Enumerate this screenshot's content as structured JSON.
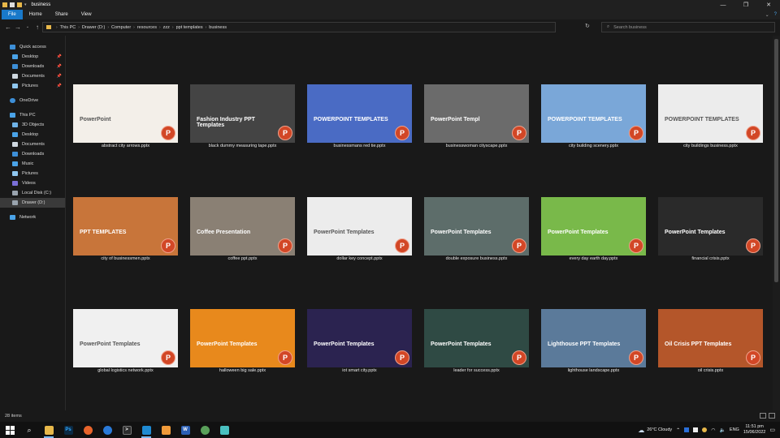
{
  "window": {
    "title": "business",
    "controls": [
      "—",
      "❐",
      "✕"
    ]
  },
  "ribbon": {
    "tabs": [
      "File",
      "Home",
      "Share",
      "View"
    ]
  },
  "address": {
    "crumbs": [
      "This PC",
      "Drawer (D:)",
      "Computer",
      "resources",
      "zzz",
      "ppt templates",
      "business"
    ],
    "search_placeholder": "Search business"
  },
  "sidebar": {
    "quick_access": {
      "label": "Quick access",
      "items": [
        "Desktop",
        "Downloads",
        "Documents",
        "Pictures"
      ]
    },
    "onedrive": "OneDrive",
    "this_pc": {
      "label": "This PC",
      "items": [
        "3D Objects",
        "Desktop",
        "Documents",
        "Downloads",
        "Music",
        "Pictures",
        "Videos",
        "Local Disk (C:)",
        "Drawer (D:)"
      ]
    },
    "network": "Network"
  },
  "files": [
    {
      "name": "abstract city arrows.pptx",
      "thumb_title": "PowerPoint",
      "bg": "#f3efe9"
    },
    {
      "name": "black dummy measuring tape.pptx",
      "thumb_title": "Fashion Industry PPT Templates",
      "bg": "#444444"
    },
    {
      "name": "businessmans red tie.pptx",
      "thumb_title": "POWERPOINT TEMPLATES",
      "bg": "#4a6bc4"
    },
    {
      "name": "businesswoman cityscape.pptx",
      "thumb_title": "PowerPoint Templ",
      "bg": "#6b6b6b"
    },
    {
      "name": "city building scenery.pptx",
      "thumb_title": "POWERPOINT TEMPLATES",
      "bg": "#7aa7d8"
    },
    {
      "name": "city buildings business.pptx",
      "thumb_title": "POWERPOINT TEMPLATES",
      "bg": "#ececec"
    },
    {
      "name": "city of businessmen.pptx",
      "thumb_title": "PPT TEMPLATES",
      "bg": "#c8753a"
    },
    {
      "name": "coffee ppt.pptx",
      "thumb_title": "Coffee Presentation",
      "bg": "#8a8074"
    },
    {
      "name": "dollar key concept.pptx",
      "thumb_title": "PowerPoint Templates",
      "bg": "#ececec"
    },
    {
      "name": "double exposure business.pptx",
      "thumb_title": "PowerPoint Templates",
      "bg": "#5d6d6a"
    },
    {
      "name": "every day earth day.pptx",
      "thumb_title": "PowerPoint Templates",
      "bg": "#79b94a"
    },
    {
      "name": "financial crisis.pptx",
      "thumb_title": "PowerPoint Templates",
      "bg": "#2a2a2a"
    },
    {
      "name": "global logistics network.pptx",
      "thumb_title": "PowerPoint Templates",
      "bg": "#f0f0f0"
    },
    {
      "name": "halloween big sale.pptx",
      "thumb_title": "PowerPoint Templates",
      "bg": "#e8891c"
    },
    {
      "name": "iot smart city.pptx",
      "thumb_title": "PowerPoint Templates",
      "bg": "#2b2350"
    },
    {
      "name": "leader for success.pptx",
      "thumb_title": "PowerPoint Templates",
      "bg": "#2f4a44"
    },
    {
      "name": "lighthouse landscape.pptx",
      "thumb_title": "Lighthouse PPT Templates",
      "bg": "#5b7a9a"
    },
    {
      "name": "oil crisis.pptx",
      "thumb_title": "Oil Crisis PPT Templates",
      "bg": "#b4562a"
    }
  ],
  "status": {
    "item_count": "28 items"
  },
  "taskbar": {
    "weather": "26°C Cloudy",
    "lang": "ENG",
    "time": "11:51 pm",
    "date": "15/06/2022"
  }
}
